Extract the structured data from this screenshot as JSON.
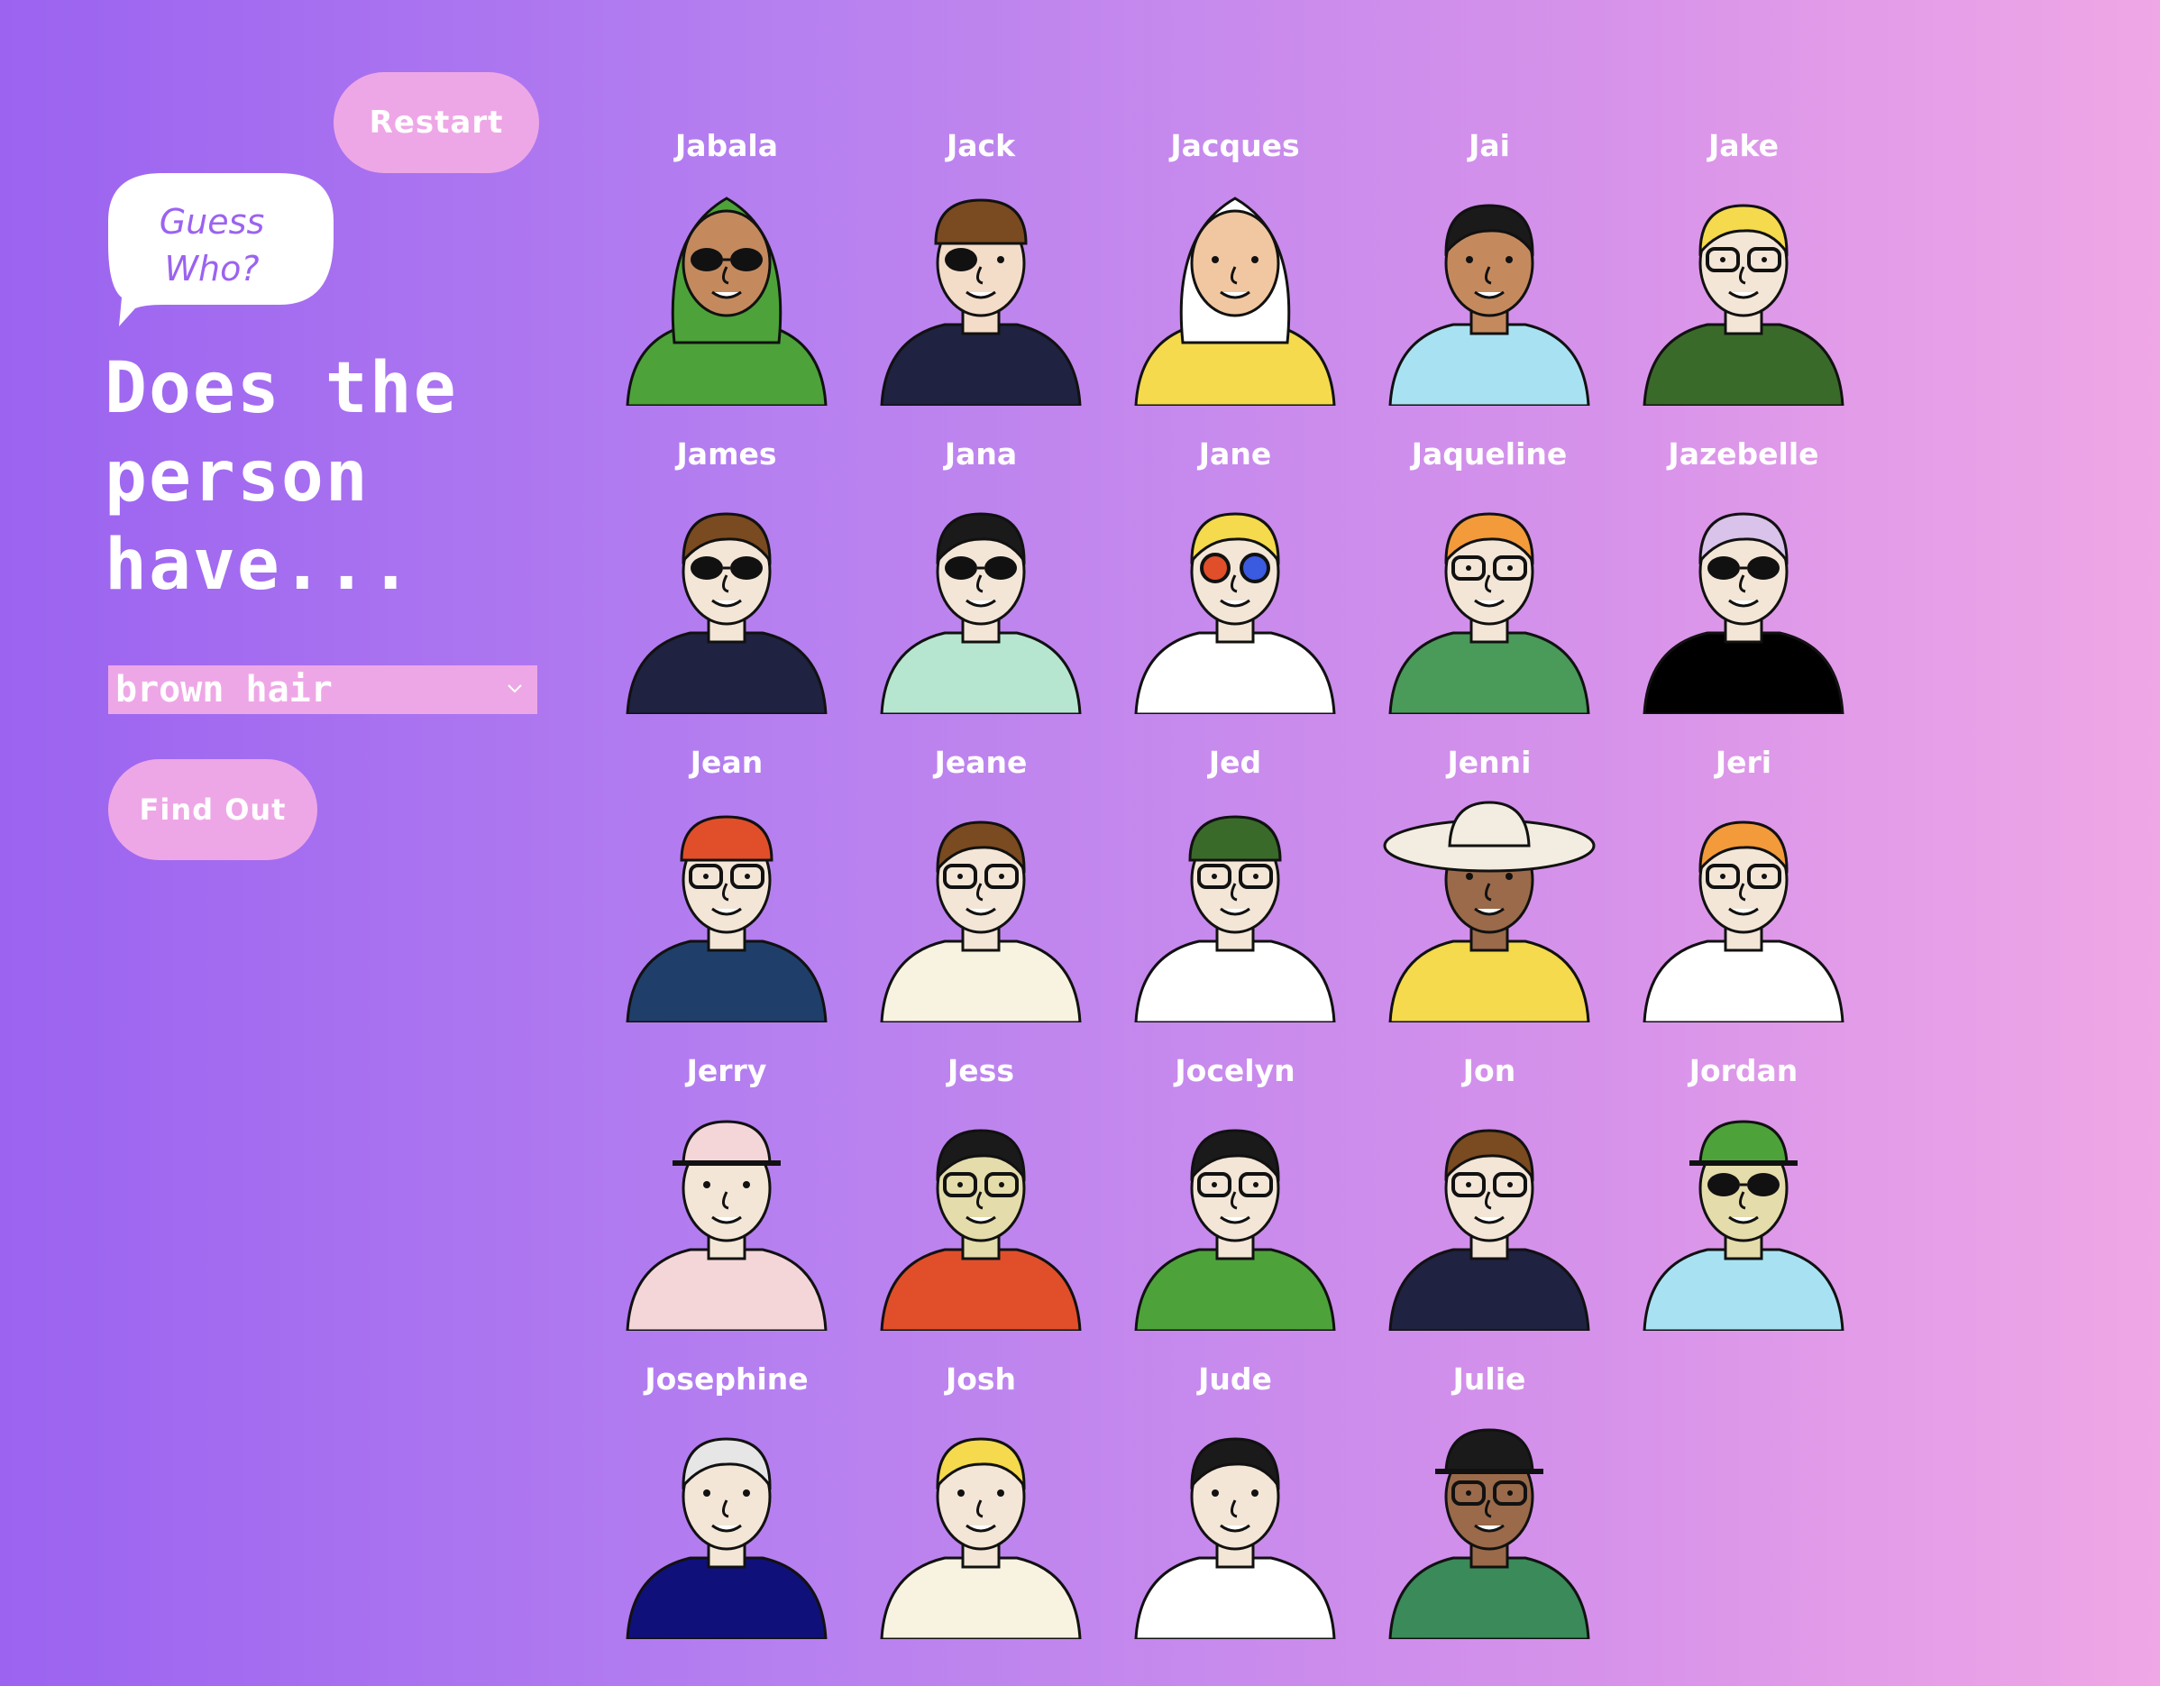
{
  "controls": {
    "restart_label": "Restart",
    "bubble_line1": "Guess",
    "bubble_line2": "Who?",
    "question_line1": "Does the",
    "question_line2": "person",
    "question_line3": "have...",
    "selected_trait": "brown hair",
    "find_out_label": "Find Out"
  },
  "colors": {
    "accent": "#eea7e6",
    "bubble_text": "#9b63f0"
  },
  "characters": [
    {
      "name": "Jabala",
      "skin": "#c48a5e",
      "hair": "#4da33a",
      "shirt": "#4da33a",
      "glasses": "sun",
      "hat": "hijab"
    },
    {
      "name": "Jack",
      "skin": "#f3dcc8",
      "hair": "#7a4a20",
      "shirt": "#1f2240",
      "glasses": "patch",
      "hat": "bandana"
    },
    {
      "name": "Jacques",
      "skin": "#f0c7a0",
      "hair": "#ffffff",
      "shirt": "#f4da4c",
      "glasses": "none",
      "hat": "raincoat"
    },
    {
      "name": "Jai",
      "skin": "#c48a5e",
      "hair": "#1a1a1a",
      "shirt": "#a8e2f2",
      "glasses": "none",
      "hat": "none"
    },
    {
      "name": "Jake",
      "skin": "#f3e6d6",
      "hair": "#f4da4c",
      "shirt": "#3a6a2a",
      "glasses": "clear",
      "hat": "none"
    },
    {
      "name": "James",
      "skin": "#f3e6d6",
      "hair": "#7a4a20",
      "shirt": "#1f2240",
      "glasses": "sun",
      "hat": "none"
    },
    {
      "name": "Jana",
      "skin": "#f3e6d6",
      "hair": "#1a1a1a",
      "shirt": "#b6e6d0",
      "glasses": "sun",
      "hat": "none"
    },
    {
      "name": "Jane",
      "skin": "#f3e6d6",
      "hair": "#f4da4c",
      "shirt": "#ffffff",
      "glasses": "color",
      "hat": "none"
    },
    {
      "name": "Jaqueline",
      "skin": "#f3e6d6",
      "hair": "#f39a3a",
      "shirt": "#4a9a5a",
      "glasses": "clear",
      "hat": "none"
    },
    {
      "name": "Jazebelle",
      "skin": "#f3e6d6",
      "hair": "#d9c3ea",
      "shirt": "#000000",
      "glasses": "sun",
      "hat": "none"
    },
    {
      "name": "Jean",
      "skin": "#f3e6d6",
      "hair": "#e14e2a",
      "shirt": "#1f3f6a",
      "glasses": "clear",
      "hat": "beanie"
    },
    {
      "name": "Jeane",
      "skin": "#f3e6d6",
      "hair": "#7a4a20",
      "shirt": "#f7f3e0",
      "glasses": "clear",
      "hat": "none"
    },
    {
      "name": "Jed",
      "skin": "#f3e6d6",
      "hair": "#3a6a2a",
      "shirt": "#ffffff",
      "glasses": "clear",
      "hat": "beanie"
    },
    {
      "name": "Jenni",
      "skin": "#9a6a4a",
      "hair": "#f2ede0",
      "shirt": "#f4da4c",
      "glasses": "none",
      "hat": "sunhat"
    },
    {
      "name": "Jeri",
      "skin": "#f3e6d6",
      "hair": "#f39a3a",
      "shirt": "#ffffff",
      "glasses": "clear",
      "hat": "none"
    },
    {
      "name": "Jerry",
      "skin": "#f3e6d6",
      "hair": "#f4d6d8",
      "shirt": "#f4d6d8",
      "glasses": "none",
      "hat": "cap"
    },
    {
      "name": "Jess",
      "skin": "#e4dcaa",
      "hair": "#1a1a1a",
      "shirt": "#e14e2a",
      "glasses": "clear",
      "hat": "none"
    },
    {
      "name": "Jocelyn",
      "skin": "#f3e6d6",
      "hair": "#1a1a1a",
      "shirt": "#4da33a",
      "glasses": "clear",
      "hat": "none"
    },
    {
      "name": "Jon",
      "skin": "#f3e6d6",
      "hair": "#7a4a20",
      "shirt": "#1f2240",
      "glasses": "clear",
      "hat": "none"
    },
    {
      "name": "Jordan",
      "skin": "#e4dcaa",
      "hair": "#4da33a",
      "shirt": "#a8e2f2",
      "glasses": "sun",
      "hat": "cap"
    },
    {
      "name": "Josephine",
      "skin": "#f3e6d6",
      "hair": "#e6e6e6",
      "shirt": "#10107a",
      "glasses": "none",
      "hat": "none"
    },
    {
      "name": "Josh",
      "skin": "#f3e6d6",
      "hair": "#f4da4c",
      "shirt": "#f7f3e0",
      "glasses": "none",
      "hat": "none"
    },
    {
      "name": "Jude",
      "skin": "#f3e6d6",
      "hair": "#1a1a1a",
      "shirt": "#ffffff",
      "glasses": "none",
      "hat": "none"
    },
    {
      "name": "Julie",
      "skin": "#9a6a4a",
      "hair": "#1a1a1a",
      "shirt": "#3a8a5a",
      "glasses": "clear",
      "hat": "cap"
    }
  ]
}
